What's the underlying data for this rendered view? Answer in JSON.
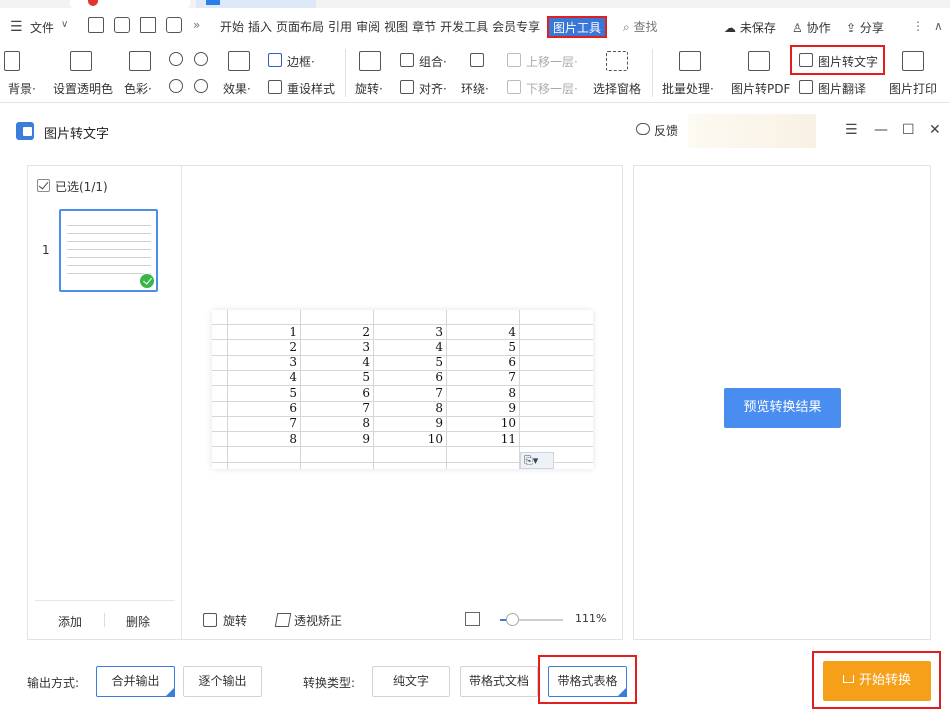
{
  "menubar": {
    "file": "文件",
    "more": "»",
    "tabs": [
      "开始",
      "插入",
      "页面布局",
      "引用",
      "审阅",
      "视图",
      "章节",
      "开发工具",
      "会员专享"
    ],
    "active_tab": "图片工具",
    "search": "查找",
    "unsaved": "未保存",
    "collab": "协作",
    "share": "分享"
  },
  "ribbon": {
    "background": "背景·",
    "transparency": "设置透明色",
    "color": "色彩·",
    "effect": "效果·",
    "border": "边框·",
    "reset_style": "重设样式",
    "rotate": "旋转·",
    "group": "组合·",
    "align": "对齐·",
    "wrap": "环绕·",
    "bring_forward": "上移一层·",
    "send_backward": "下移一层·",
    "selection_pane": "选择窗格",
    "batch": "批量处理·",
    "to_pdf": "图片转PDF",
    "to_text": "图片转文字",
    "translate": "图片翻译",
    "print": "图片打印"
  },
  "dialog": {
    "title": "图片转文字",
    "feedback": "反馈"
  },
  "left": {
    "selected": "已选(1/1)",
    "page_number": "1",
    "add": "添加",
    "delete": "删除"
  },
  "preview": {
    "rotate": "旋转",
    "perspective": "透视矫正",
    "zoom": "111%",
    "zoom_fraction": 0.111,
    "paste_badge": "⎘▾",
    "rows": [
      [
        "1",
        "2",
        "3",
        "4"
      ],
      [
        "2",
        "3",
        "4",
        "5"
      ],
      [
        "3",
        "4",
        "5",
        "6"
      ],
      [
        "4",
        "5",
        "6",
        "7"
      ],
      [
        "5",
        "6",
        "7",
        "8"
      ],
      [
        "6",
        "7",
        "8",
        "9"
      ],
      [
        "7",
        "8",
        "9",
        "10"
      ],
      [
        "8",
        "9",
        "10",
        "11"
      ]
    ]
  },
  "right": {
    "preview_button": "预览转换结果"
  },
  "bottom": {
    "output_label": "输出方式:",
    "merge": "合并输出",
    "each": "逐个输出",
    "type_label": "转换类型:",
    "plain": "纯文字",
    "doc": "带格式文档",
    "table": "带格式表格",
    "start": "开始转换"
  },
  "colors": {
    "accent": "#3a7ddb",
    "start": "#f6a01a",
    "highlight": "#e02020",
    "success": "#3ab54a"
  }
}
